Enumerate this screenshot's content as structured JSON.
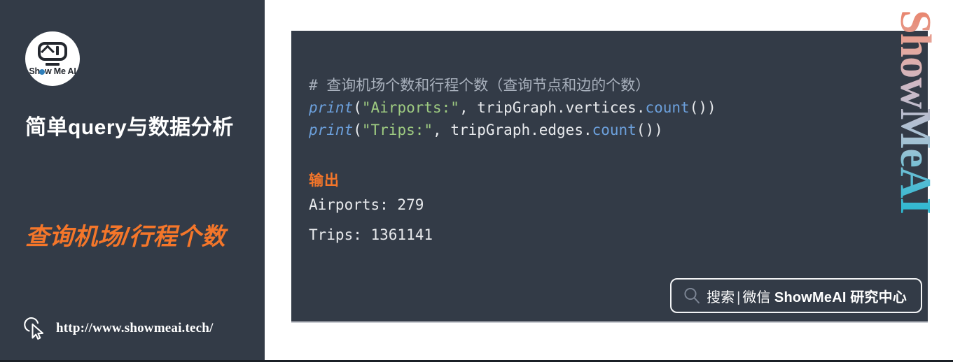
{
  "sidebar": {
    "logo": {
      "icon_name": "showmeai-robot-logo",
      "wordmark_prefix": "Sh",
      "wordmark_suffix": "w Me AI"
    },
    "title": "简单query与数据分析",
    "subtitle": "查询机场/行程个数",
    "footer": {
      "cursor_icon": "mouse-pointer-icon",
      "url": "http://www.showmeai.tech/"
    },
    "bg_color": "#333b47",
    "accent_color": "#f4762a"
  },
  "code_panel": {
    "bg_color": "#333b47",
    "lines": [
      {
        "tokens": [
          {
            "text": "# 查询机场个数和行程个数（查询节点和边的个数）",
            "type": "comment"
          }
        ]
      },
      {
        "tokens": [
          {
            "text": "print",
            "type": "kw"
          },
          {
            "text": "(",
            "type": "plain"
          },
          {
            "text": "\"Airports:\"",
            "type": "str"
          },
          {
            "text": ", tripGraph.vertices.",
            "type": "plain"
          },
          {
            "text": "count",
            "type": "fn"
          },
          {
            "text": "())",
            "type": "plain"
          }
        ]
      },
      {
        "tokens": [
          {
            "text": "print",
            "type": "kw"
          },
          {
            "text": "(",
            "type": "plain"
          },
          {
            "text": "\"Trips:\"",
            "type": "str"
          },
          {
            "text": ", tripGraph.edges.",
            "type": "plain"
          },
          {
            "text": "count",
            "type": "fn"
          },
          {
            "text": "())",
            "type": "plain"
          }
        ]
      }
    ],
    "output_label": "输出",
    "output_lines": [
      "Airports: 279",
      "Trips: 1361141"
    ],
    "search_pill": {
      "icon_name": "magnifier-icon",
      "search_label": "搜索",
      "separator": "|",
      "channel_label": "微信",
      "brand": "ShowMeAI",
      "suffix": "研究中心"
    }
  },
  "vertical_brand": {
    "text": "ShowMeAI",
    "gradient_from": "#e8836b",
    "gradient_to": "#2bb8d0"
  }
}
